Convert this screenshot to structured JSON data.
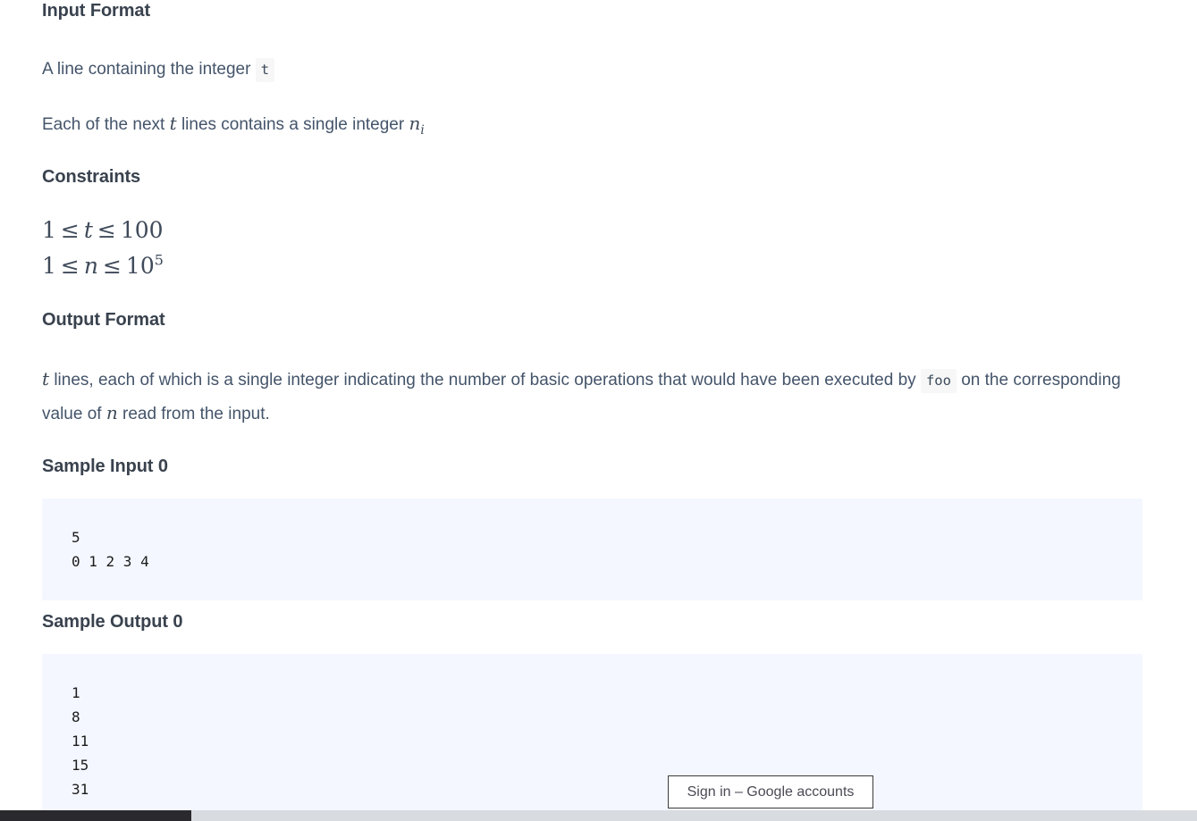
{
  "document": {
    "sections": [
      {
        "heading": "Input Format"
      },
      {
        "heading": "Constraints"
      },
      {
        "heading": "Output Format"
      },
      {
        "heading": "Sample Input 0"
      },
      {
        "heading": "Sample Output 0"
      }
    ]
  },
  "input_format": {
    "heading": "Input Format",
    "line1_before": "A line containing the integer",
    "line1_code": "t",
    "line2_before": "Each of the next",
    "line2_var": "t",
    "line2_middle": "lines contains a single integer",
    "line2_var2": "n",
    "line2_var2_sub": "i"
  },
  "constraints": {
    "heading": "Constraints",
    "lines": [
      {
        "lhs": "1",
        "rel1": "≤",
        "var": "t",
        "rel2": "≤",
        "rhs": "100",
        "exp": ""
      },
      {
        "lhs": "1",
        "rel1": "≤",
        "var": "n",
        "rel2": "≤",
        "rhs": "10",
        "exp": "5"
      }
    ]
  },
  "output_format": {
    "heading": "Output Format",
    "var1": "t",
    "text1": "lines, each of which is a single integer indicating the number of basic operations that would have been executed by",
    "code1": "foo",
    "text2": "on the corresponding value of",
    "var2": "n",
    "text3": "read from the input."
  },
  "sample_input": {
    "heading": "Sample Input 0",
    "content": "5\n0 1 2 3 4"
  },
  "sample_output": {
    "heading": "Sample Output 0",
    "content": "1\n8\n11\n15\n31"
  },
  "signin_popup": {
    "title": "Sign in – Google accounts"
  },
  "colors": {
    "heading": "#39424e",
    "body_text": "#44546a",
    "code_block_bg": "#f4f7ff",
    "inline_code_bg": "#f7f7f7",
    "scrollbar_thumb": "#2a2a2e",
    "scrollbar_track": "#d8dbe0",
    "popup_border": "#3c3c3c"
  }
}
